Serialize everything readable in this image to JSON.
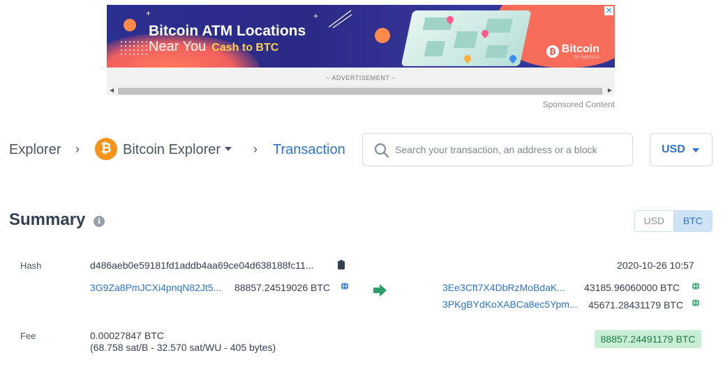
{
  "ad": {
    "title": "Bitcoin ATM Locations",
    "subtitle": "Near You",
    "cta": "Cash to BTC",
    "brand": "Bitcoin",
    "brand_sub": "OF AMERICA",
    "label": "~ ADVERTISEMENT ~",
    "close_icon": "close-icon",
    "sponsored": "Sponsored Content"
  },
  "breadcrumb": {
    "root": "Explorer",
    "explorer": "Bitcoin Explorer",
    "current": "Transaction",
    "separator": "›"
  },
  "search": {
    "placeholder": "Search your transaction, an address or a block"
  },
  "currency": {
    "selected": "USD"
  },
  "summary": {
    "title": "Summary",
    "toggle": {
      "usd": "USD",
      "btc": "BTC",
      "active": "BTC"
    },
    "hash_label": "Hash",
    "hash": "d486aeb0e59181fd1addb4aa69ce04d638188fc11...",
    "timestamp": "2020-10-26 10:57",
    "inputs": [
      {
        "address": "3G9Za8PmJCXi4pnqN82Jt5...",
        "amount": "88857.24519026 BTC"
      }
    ],
    "outputs": [
      {
        "address": "3Ee3Cft7X4DbRzMoBdaK...",
        "amount": "43185.96060000 BTC"
      },
      {
        "address": "3PKgBYdKoXABCa8ec5Ypm...",
        "amount": "45671.28431179 BTC"
      }
    ],
    "fee_label": "Fee",
    "fee": "0.00027847 BTC",
    "fee_detail": "(68.758 sat/B - 32.570 sat/WU - 405 bytes)",
    "total": "88857.24491179 BTC"
  },
  "colors": {
    "accent": "#2c74c9",
    "bitcoin": "#f7931a",
    "success": "#2e9e6a",
    "total_bg": "#c8eed6"
  }
}
